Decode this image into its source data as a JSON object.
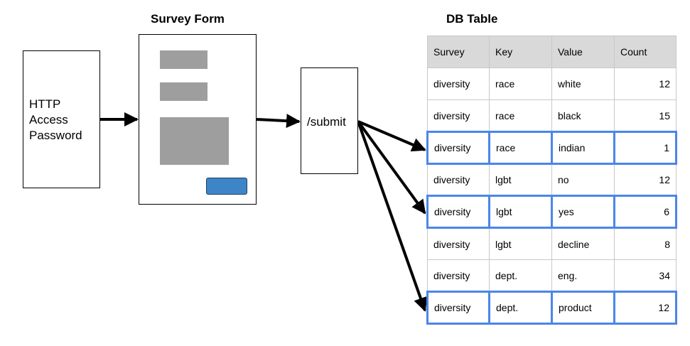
{
  "titles": {
    "survey_form": "Survey Form",
    "db_table": "DB Table"
  },
  "http_box": {
    "label": "HTTP\nAccess\nPassword"
  },
  "submit_box": {
    "label": "/submit"
  },
  "table": {
    "headers": [
      "Survey",
      "Key",
      "Value",
      "Count"
    ],
    "rows": [
      {
        "survey": "diversity",
        "key": "race",
        "value": "white",
        "count": "12",
        "highlighted": false
      },
      {
        "survey": "diversity",
        "key": "race",
        "value": "black",
        "count": "15",
        "highlighted": false
      },
      {
        "survey": "diversity",
        "key": "race",
        "value": "indian",
        "count": "1",
        "highlighted": true
      },
      {
        "survey": "diversity",
        "key": "lgbt",
        "value": "no",
        "count": "12",
        "highlighted": false
      },
      {
        "survey": "diversity",
        "key": "lgbt",
        "value": "yes",
        "count": "6",
        "highlighted": true
      },
      {
        "survey": "diversity",
        "key": "lgbt",
        "value": "decline",
        "count": "8",
        "highlighted": false
      },
      {
        "survey": "diversity",
        "key": "dept.",
        "value": "eng.",
        "count": "34",
        "highlighted": false
      },
      {
        "survey": "diversity",
        "key": "dept.",
        "value": "product",
        "count": "12",
        "highlighted": true
      }
    ]
  },
  "colors": {
    "highlight_border": "#4a86e8",
    "header_bg": "#d9d9d9",
    "placeholder_gray": "#9e9e9e",
    "submit_button": "#3d85c6"
  }
}
